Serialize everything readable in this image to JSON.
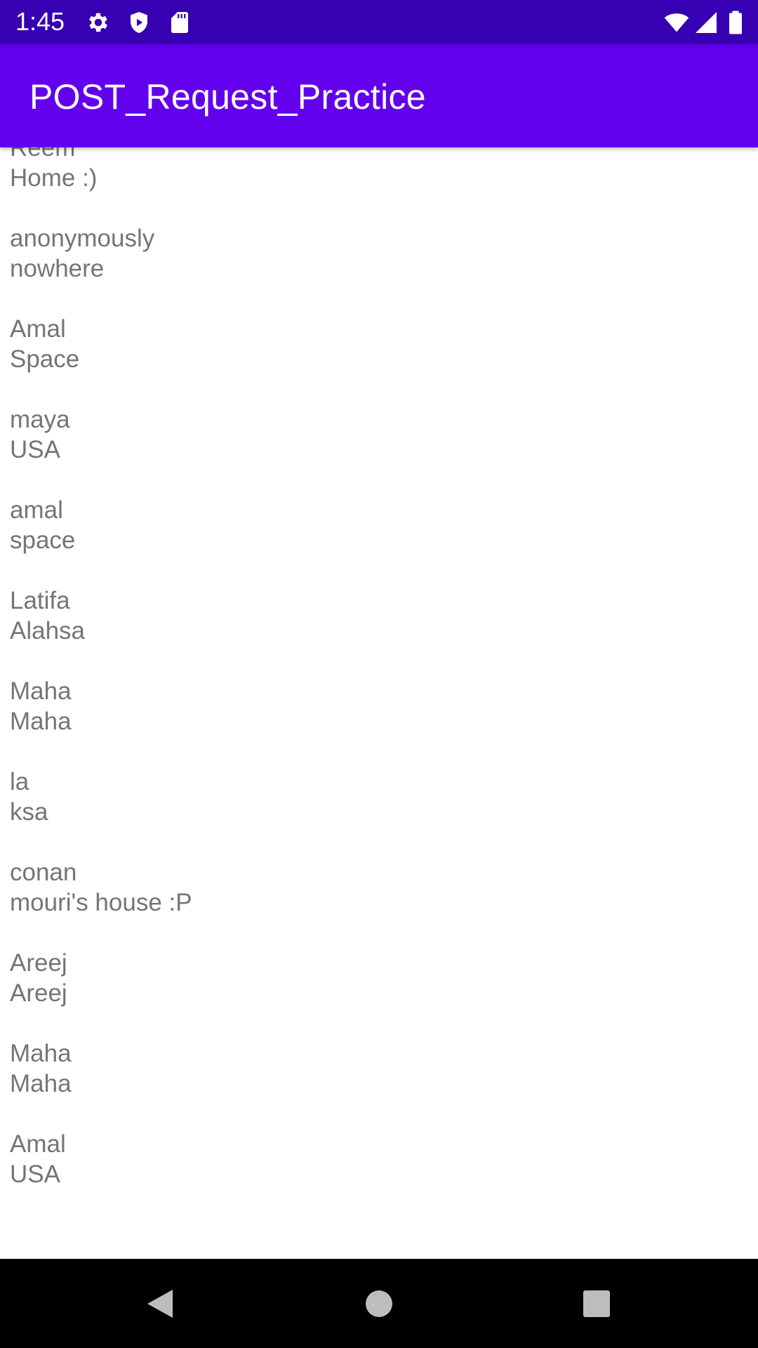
{
  "status_bar": {
    "time": "1:45",
    "icons": [
      "gear-icon",
      "shield-play-icon",
      "sd-card-icon",
      "wifi-icon",
      "signal-icon",
      "battery-icon"
    ]
  },
  "app_bar": {
    "title": "POST_Request_Practice"
  },
  "list": {
    "items": [
      {
        "name": "Reem",
        "location": "Home :)"
      },
      {
        "name": "anonymously",
        "location": "nowhere"
      },
      {
        "name": "Amal",
        "location": "Space"
      },
      {
        "name": "maya",
        "location": "USA"
      },
      {
        "name": "amal",
        "location": "space"
      },
      {
        "name": "Latifa",
        "location": "Alahsa"
      },
      {
        "name": "Maha",
        "location": "Maha"
      },
      {
        "name": "la",
        "location": "ksa"
      },
      {
        "name": "conan",
        "location": "mouri's house :P"
      },
      {
        "name": "Areej",
        "location": "Areej"
      },
      {
        "name": "Maha",
        "location": "Maha"
      },
      {
        "name": "Amal",
        "location": "USA"
      }
    ]
  },
  "nav_bar": {
    "buttons": [
      "back-icon",
      "home-icon",
      "recents-icon"
    ]
  },
  "colors": {
    "status_bar": "#3700b3",
    "app_bar": "#6200ee",
    "text": "#757575",
    "nav_bar": "#000000"
  }
}
